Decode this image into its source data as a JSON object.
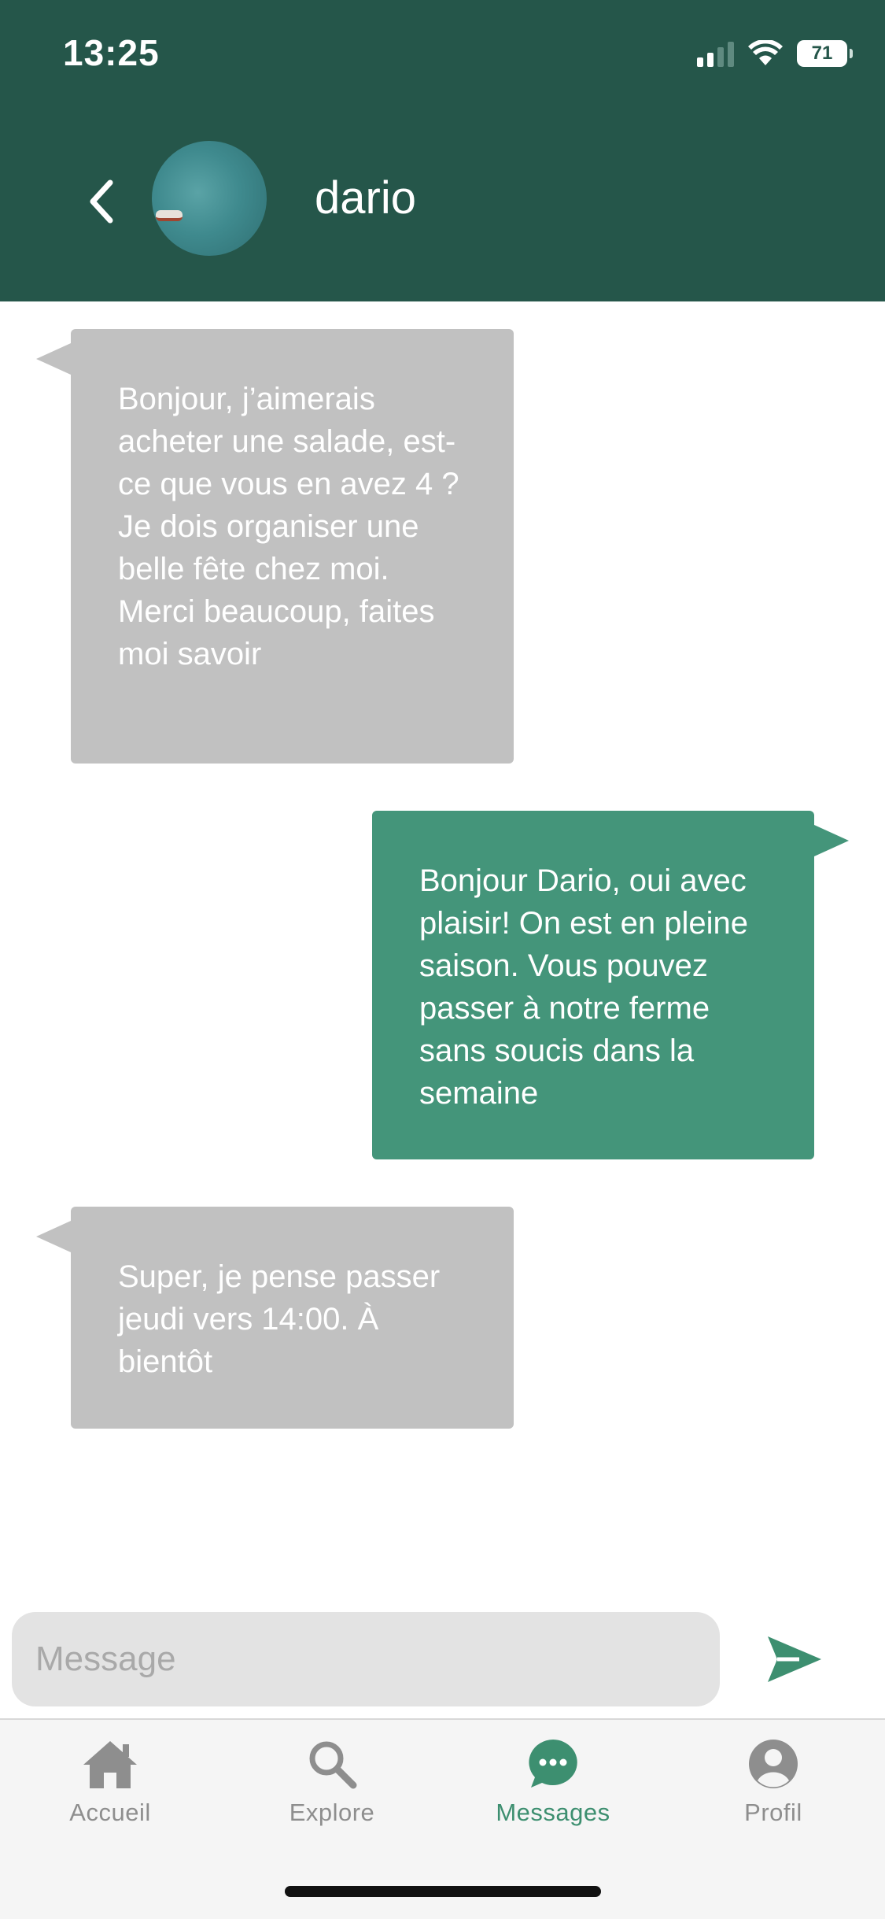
{
  "status_bar": {
    "time": "13:25",
    "battery": "71"
  },
  "header": {
    "contact_name": "dario"
  },
  "messages": [
    {
      "direction": "incoming",
      "text": "Bonjour, j’aimerais acheter une salade, est-ce que vous en avez 4 ? Je dois organiser une belle fête chez moi. Merci beaucoup, faites moi savoir"
    },
    {
      "direction": "outgoing",
      "text": "Bonjour Dario, oui avec plaisir! On est en pleine saison. Vous pouvez passer à notre ferme sans soucis dans la semaine"
    },
    {
      "direction": "incoming",
      "text": "Super, je pense passer jeudi vers 14:00. À bientôt"
    }
  ],
  "composer": {
    "placeholder": "Message",
    "value": ""
  },
  "tabs": [
    {
      "label": "Accueil",
      "icon": "home-icon",
      "active": false
    },
    {
      "label": "Explore",
      "icon": "search-icon",
      "active": false
    },
    {
      "label": "Messages",
      "icon": "chat-bubble-icon",
      "active": true
    },
    {
      "label": "Profil",
      "icon": "user-profile-icon",
      "active": false
    }
  ],
  "colors": {
    "header_bg": "#25564a",
    "incoming_bubble": "#c1c1c1",
    "outgoing_bubble": "#44957a",
    "accent": "#3d8f70",
    "inactive_tab": "#8e8e8e"
  }
}
